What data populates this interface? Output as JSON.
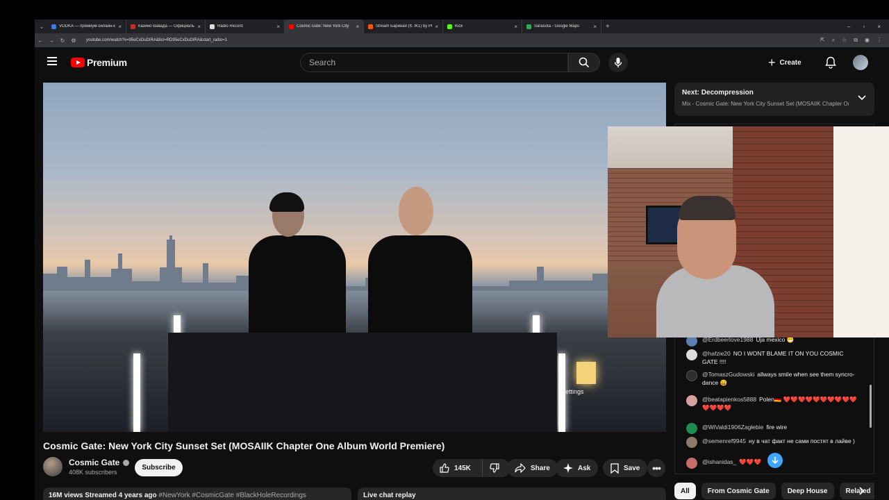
{
  "browser": {
    "tabs": [
      {
        "title": "VODKA — премиум онлайн-ка",
        "color": "#3d7bd9"
      },
      {
        "title": "Казино Вавада — Официальн",
        "color": "#c22e2e"
      },
      {
        "title": "Radio Record",
        "color": "#dddddd"
      },
      {
        "title": "Cosmic Gate: New York City",
        "color": "#ff0000",
        "active": true
      },
      {
        "title": "Stream Бариная (ft. Ж1) by Pho",
        "color": "#ff5500"
      },
      {
        "title": "Kick",
        "color": "#53fc18"
      },
      {
        "title": "Sarasota - Google Maps",
        "color": "#34a853"
      }
    ],
    "url": "youtube.com/watch?v=95eCxDuDIRA&list=RD95eCxDuDIRA&start_radio=1"
  },
  "masthead": {
    "logo_text": "Premium",
    "search_placeholder": "Search",
    "create_label": "Create"
  },
  "video": {
    "title": "Cosmic Gate: New York City Sunset Set (MOSAIIK Chapter One Album World Premiere)",
    "settings_tooltip": "Settings",
    "channel_name": "Cosmic Gate",
    "subscribers": "408K subscribers",
    "subscribe_label": "Subscribe",
    "like_count": "145K",
    "share_label": "Share",
    "ask_label": "Ask",
    "save_label": "Save",
    "views_date": "16M views  Streamed 4 years ago",
    "tags": "#NewYork #CosmicGate #BlackHoleRecordings",
    "live_chat_replay": "Live chat replay"
  },
  "up_next": {
    "title": "Next: Decompression",
    "subtitle": "Mix - Cosmic Gate: New York City Sunset Set (MOSAIIK Chapter One Album World Premiere)"
  },
  "chat": [
    {
      "author": "@Erdbeerlove1988",
      "message": "Uja mexico 😁",
      "color": "#5c7fb0"
    },
    {
      "author": "@hafzie20",
      "message": "NO I WONT BLAME IT ON YOU COSMIC GATE !!!!",
      "color": "#dddddd"
    },
    {
      "author": "@TomaszGudowski",
      "message": "allways smile when see them syncro-dance 😀",
      "color": "#2d2d2d"
    },
    {
      "author": "@beatapienkos5888",
      "message": "Polen🇩🇪 ❤️❤️❤️❤️❤️❤️❤️❤️❤️❤️❤️❤️❤️❤️",
      "color": "#d9a0a0"
    },
    {
      "author": "@WiValdi1906Zagłebie",
      "message": "fire wire",
      "color": "#1e8c4f"
    },
    {
      "author": "@semenref9945",
      "message": "ну в чат факт не сами постят в лайве )",
      "color": "#8b7b6a"
    },
    {
      "author": "@ishanidas_",
      "message": "❤️❤️❤️",
      "color": "#c76b6b"
    }
  ],
  "chips": [
    "All",
    "From Cosmic Gate",
    "Deep House",
    "Related"
  ]
}
